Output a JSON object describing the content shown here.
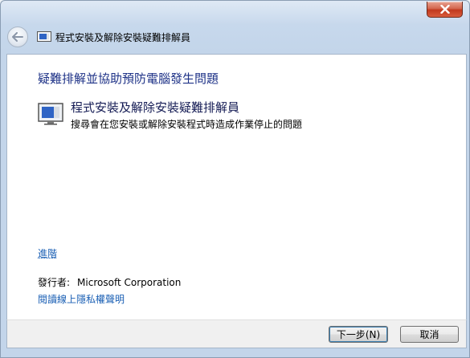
{
  "window": {
    "title": "程式安裝及解除安裝疑難排解員"
  },
  "content": {
    "heading": "疑難排解並協助預防電腦發生問題",
    "item": {
      "title": "程式安裝及解除安裝疑難排解員",
      "description": "搜尋會在您安裝或解除安裝程式時造成作業停止的問題"
    },
    "advanced_link": "進階",
    "publisher_label": "發行者:",
    "publisher_value": "Microsoft Corporation",
    "privacy_link": "閱讀線上隱私權聲明"
  },
  "footer": {
    "next_button": "下一步(N)",
    "cancel_button": "取消"
  },
  "icons": {
    "close": "close-icon",
    "back": "back-arrow-icon",
    "troubleshooter": "computer-screen-icon"
  },
  "colors": {
    "heading": "#1e3287",
    "link": "#1a5fb4",
    "close_button": "#c1391e"
  }
}
